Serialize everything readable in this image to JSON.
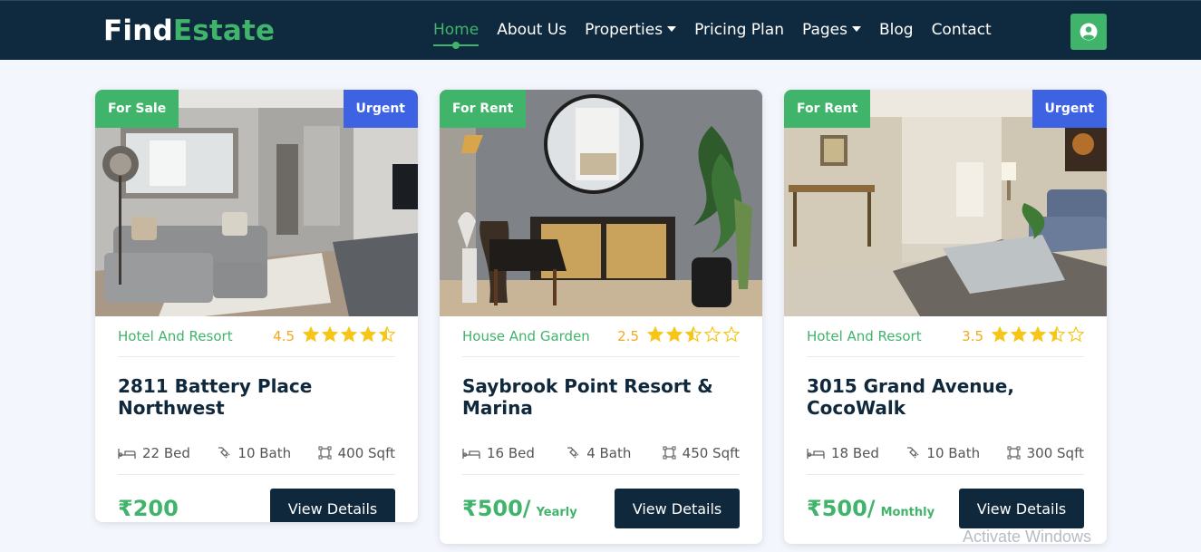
{
  "brand": {
    "part1": "Find",
    "part2": "Estate"
  },
  "nav": {
    "items": [
      {
        "label": "Home",
        "active": true,
        "dropdown": false
      },
      {
        "label": "About Us",
        "active": false,
        "dropdown": false
      },
      {
        "label": "Properties",
        "active": false,
        "dropdown": true
      },
      {
        "label": "Pricing Plan",
        "active": false,
        "dropdown": false
      },
      {
        "label": "Pages",
        "active": false,
        "dropdown": true
      },
      {
        "label": "Blog",
        "active": false,
        "dropdown": false
      },
      {
        "label": "Contact",
        "active": false,
        "dropdown": false
      }
    ]
  },
  "cards": [
    {
      "status": "For Sale",
      "tag": "Urgent",
      "category": "Hotel And Resort",
      "rating": "4.5",
      "stars": 4.5,
      "title": "2811 Battery Place Northwest",
      "beds": "22 Bed",
      "baths": "10 Bath",
      "area": "400 Sqft",
      "price": "₹200",
      "period": "",
      "button": "View Details"
    },
    {
      "status": "For Rent",
      "tag": "",
      "category": "House And Garden",
      "rating": "2.5",
      "stars": 2.5,
      "title": "Saybrook Point Resort & Marina",
      "beds": "16 Bed",
      "baths": "4 Bath",
      "area": "450 Sqft",
      "price": "₹500/",
      "period": "Yearly",
      "button": "View Details"
    },
    {
      "status": "For Rent",
      "tag": "Urgent",
      "category": "Hotel And Resort",
      "rating": "3.5",
      "stars": 3.5,
      "title": "3015 Grand Avenue, CocoWalk",
      "beds": "18 Bed",
      "baths": "10 Bath",
      "area": "300 Sqft",
      "price": "₹500/",
      "period": "Monthly",
      "button": "View Details"
    }
  ],
  "watermark": "Activate Windows",
  "colors": {
    "primary": "#3fb46a",
    "navy": "#0f2a3e",
    "urgent": "#3d63e3",
    "star": "#f5c518"
  }
}
